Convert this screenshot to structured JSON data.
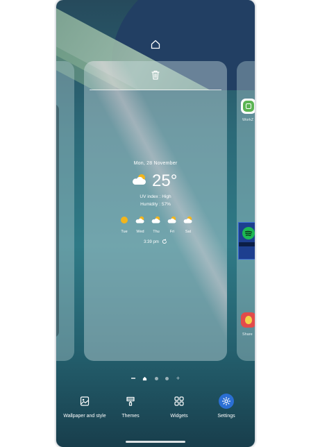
{
  "screen": {
    "top_actions": {
      "home_icon": "home-icon",
      "delete_icon": "trash-icon"
    },
    "weather": {
      "date": "Mon, 28 November",
      "temperature": "25°",
      "uv": "UV index : High",
      "humidity": "Humidity : 57%",
      "forecast": [
        {
          "day": "Tue",
          "icon": "sun-icon"
        },
        {
          "day": "Wed",
          "icon": "partly-cloudy-icon"
        },
        {
          "day": "Thu",
          "icon": "partly-cloudy-icon"
        },
        {
          "day": "Fri",
          "icon": "partly-cloudy-icon"
        },
        {
          "day": "Sat",
          "icon": "partly-cloudy-icon"
        }
      ],
      "updated_time": "3:39 pm"
    },
    "right_page_apps": [
      {
        "label": "WorkZ",
        "color": "#5bb453"
      },
      {
        "label": "",
        "color": "#1db954"
      },
      {
        "label": "Share",
        "color": "#e24b4b"
      }
    ],
    "page_indicator": {
      "current_index": 1,
      "count": 3
    },
    "bottom_options": [
      {
        "label": "Wallpaper and style",
        "icon": "wallpaper-icon"
      },
      {
        "label": "Themes",
        "icon": "brush-icon"
      },
      {
        "label": "Widgets",
        "icon": "widgets-icon"
      },
      {
        "label": "Settings",
        "icon": "settings-gear-icon"
      }
    ],
    "accent": "#2b6fd4"
  }
}
